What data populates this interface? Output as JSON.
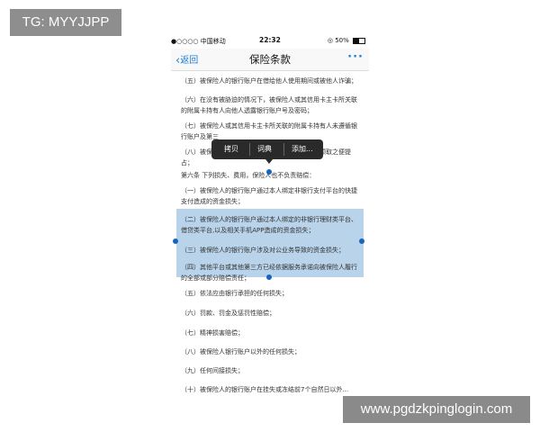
{
  "tag": "TG: MYYJJPP",
  "watermark": "www.pgdzkpinglogin.com",
  "status_bar": {
    "carrier": "●○○○○ 中国移动",
    "time": "22:32",
    "battery_text": "50%"
  },
  "nav": {
    "back_label": "返回",
    "title": "保险条款",
    "more": "···"
  },
  "context_menu": [
    "拷贝",
    "词典",
    "添加..."
  ],
  "paragraphs": [
    "（五）被保险人的银行账户在借给他人使用期间或被他人诈骗；",
    "（六）在没有被胁迫的情况下，被保险人或其信用卡主卡所关联的附属卡持有人向他人透露银行账户号及密码；",
    "（七）被保险人或其信用卡主卡所关联的附属卡持有人未遵循银行账户及第三",
    "（八）被保险人的银行账户被冒领，并从冒领时间领取之便提占；",
    "第六条 下列损失、费用，保险人也不负责赔偿：",
    "（一）被保险人的银行账户通过本人绑定非银行支付平台的快捷支付造成的资金损失；",
    "（二）被保险人的银行账户通过本人绑定的非银行理财类平台、借贷类平台,以及相关手机APP造成的资金损失；",
    "（三）被保险人的银行账户涉及对公业务导致的资金损失；",
    "（四）其他平台或其他第三方已经依据服务承诺向被保险人履行的全部或部分赔偿责任；",
    "（五）依法应由银行承担的任何损失；",
    "（六）罚款、罚金及惩罚性赔偿；",
    "（七）精神损害赔偿；",
    "（八）被保险人银行账户以外的任何损失；",
    "（九）任何间接损失；",
    "（十）被保险人的银行账户在挂失或冻结前7个自然日以外..."
  ]
}
